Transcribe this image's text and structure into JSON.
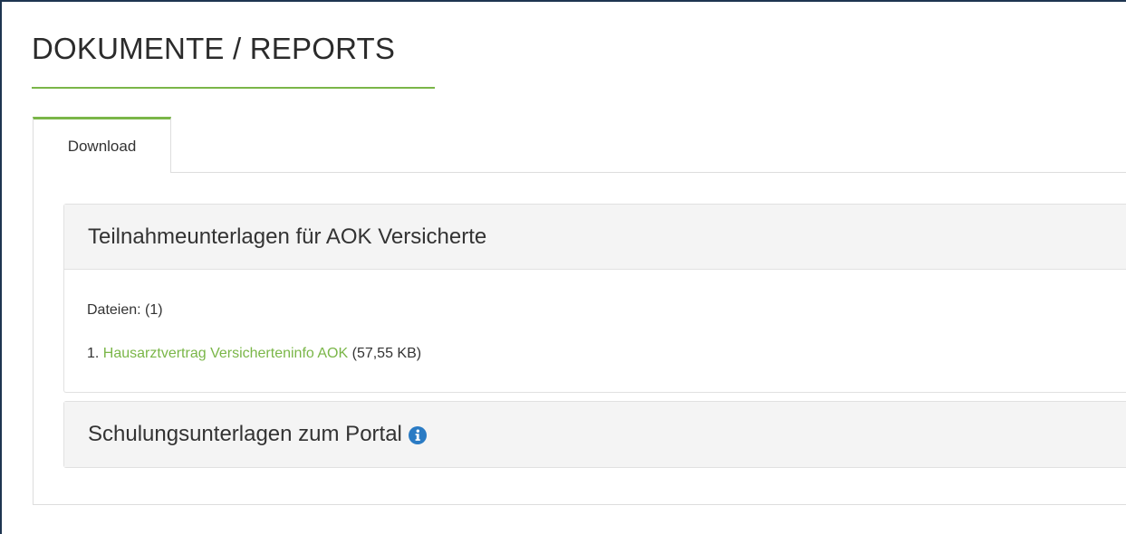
{
  "page": {
    "title": "DOKUMENTE / REPORTS"
  },
  "tabs": [
    {
      "label": "Download",
      "active": true
    }
  ],
  "sections": [
    {
      "title": "Teilnahmeunterlagen für AOK Versicherte",
      "expanded": true,
      "files_label": "Dateien: (1)",
      "files": [
        {
          "index": "1.",
          "name": "Hausarztvertrag Versicherteninfo AOK",
          "size": "(57,55 KB)"
        }
      ]
    },
    {
      "title": "Schulungsunterlagen zum Portal",
      "expanded": false,
      "icon": "info-circle-icon"
    }
  ],
  "colors": {
    "accent": "#7ab648",
    "info": "#2a7bc4",
    "frame": "#1e3550"
  }
}
